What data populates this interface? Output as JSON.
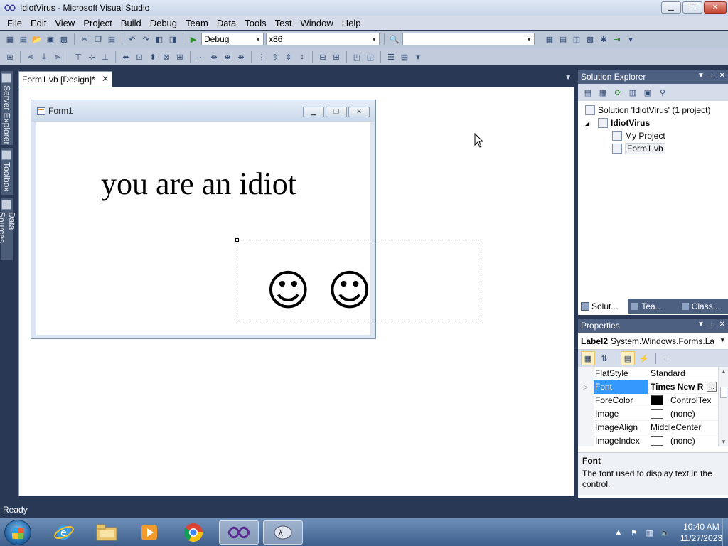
{
  "window": {
    "title": "IdiotVirus - Microsoft Visual Studio",
    "minimize": "▁",
    "maximize": "❐",
    "close": "✕"
  },
  "menu": [
    "File",
    "Edit",
    "View",
    "Project",
    "Build",
    "Debug",
    "Team",
    "Data",
    "Tools",
    "Test",
    "Window",
    "Help"
  ],
  "toolbar": {
    "config": "Debug",
    "platform": "x86",
    "find": ""
  },
  "left_tabs": [
    "Server Explorer",
    "Toolbox",
    "Data Sources"
  ],
  "document": {
    "tab_label": "Form1.vb [Design]*",
    "tab_close": "✕"
  },
  "form": {
    "title": "Form1",
    "label1_text": "you are an idiot",
    "label2_text": "☺☺"
  },
  "solution_explorer": {
    "title": "Solution Explorer",
    "solution": "Solution 'IdiotVirus' (1 project)",
    "project": "IdiotVirus",
    "items": [
      "My Project",
      "Form1.vb"
    ],
    "tabs": [
      "Solut...",
      "Tea...",
      "Class..."
    ]
  },
  "properties": {
    "title": "Properties",
    "object_name": "Label2",
    "object_type": "System.Windows.Forms.La",
    "rows": [
      {
        "name": "FlatStyle",
        "value": "Standard"
      },
      {
        "name": "Font",
        "value": "Times New R"
      },
      {
        "name": "ForeColor",
        "value": "ControlTex"
      },
      {
        "name": "Image",
        "value": "(none)"
      },
      {
        "name": "ImageAlign",
        "value": "MiddleCenter"
      },
      {
        "name": "ImageIndex",
        "value": "(none)"
      }
    ],
    "desc_title": "Font",
    "desc_text": "The font used to display text in the control."
  },
  "status": {
    "text": "Ready"
  },
  "taskbar": {
    "time": "10:40 AM",
    "date": "11/27/2023"
  },
  "colors": {
    "chrome": "#293955",
    "selection": "#3399ff"
  }
}
